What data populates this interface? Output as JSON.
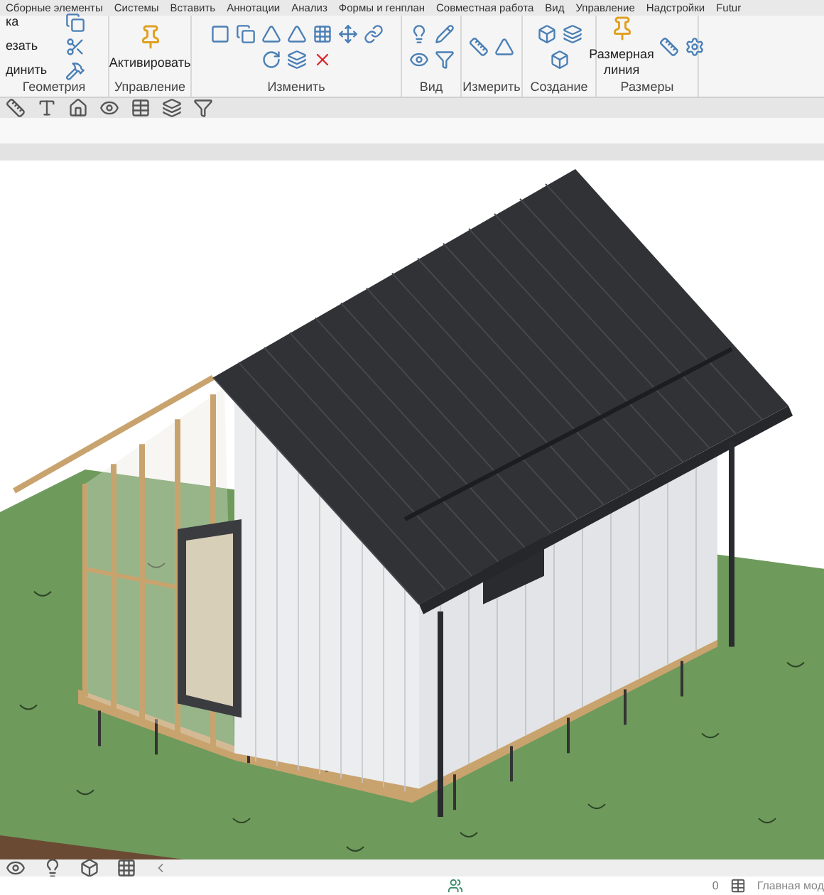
{
  "ribbon_tabs": [
    "Сборные элементы",
    "Системы",
    "Вставить",
    "Аннотации",
    "Анализ",
    "Формы и генплан",
    "Совместная работа",
    "Вид",
    "Управление",
    "Надстройки",
    "Futur"
  ],
  "panels": [
    {
      "label": "Геометрия",
      "buttons": [
        "ка",
        "езать",
        "динить"
      ]
    },
    {
      "label": "Управление",
      "large_button": "Активировать"
    },
    {
      "label": "Изменить"
    },
    {
      "label": "Вид"
    },
    {
      "label": "Измерить"
    },
    {
      "label": "Создание"
    },
    {
      "label": "Размеры",
      "large_button": "Размерная линия"
    }
  ],
  "status_bar": {
    "count": "0",
    "model": "Главная мод"
  }
}
